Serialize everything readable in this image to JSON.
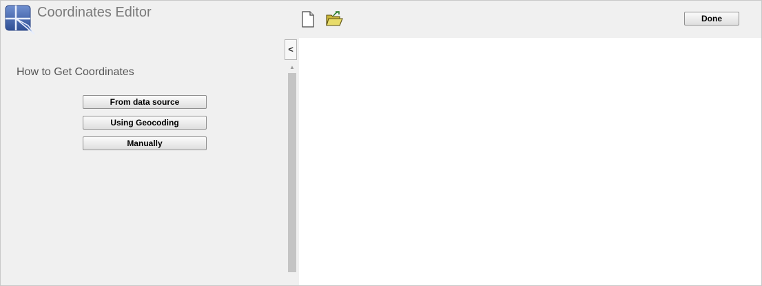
{
  "app": {
    "title": "Coordinates Editor",
    "logo_icon": "map-pointer-logo",
    "brand_color": "#3b5da8"
  },
  "toolbar": {
    "new_icon": "new-document-icon",
    "open_icon": "open-folder-icon",
    "done_label": "Done"
  },
  "sidebar": {
    "collapse_label": "<",
    "section_title": "How to Get Coordinates",
    "buttons": [
      {
        "label": "From data source"
      },
      {
        "label": "Using Geocoding"
      },
      {
        "label": "Manually"
      }
    ]
  }
}
